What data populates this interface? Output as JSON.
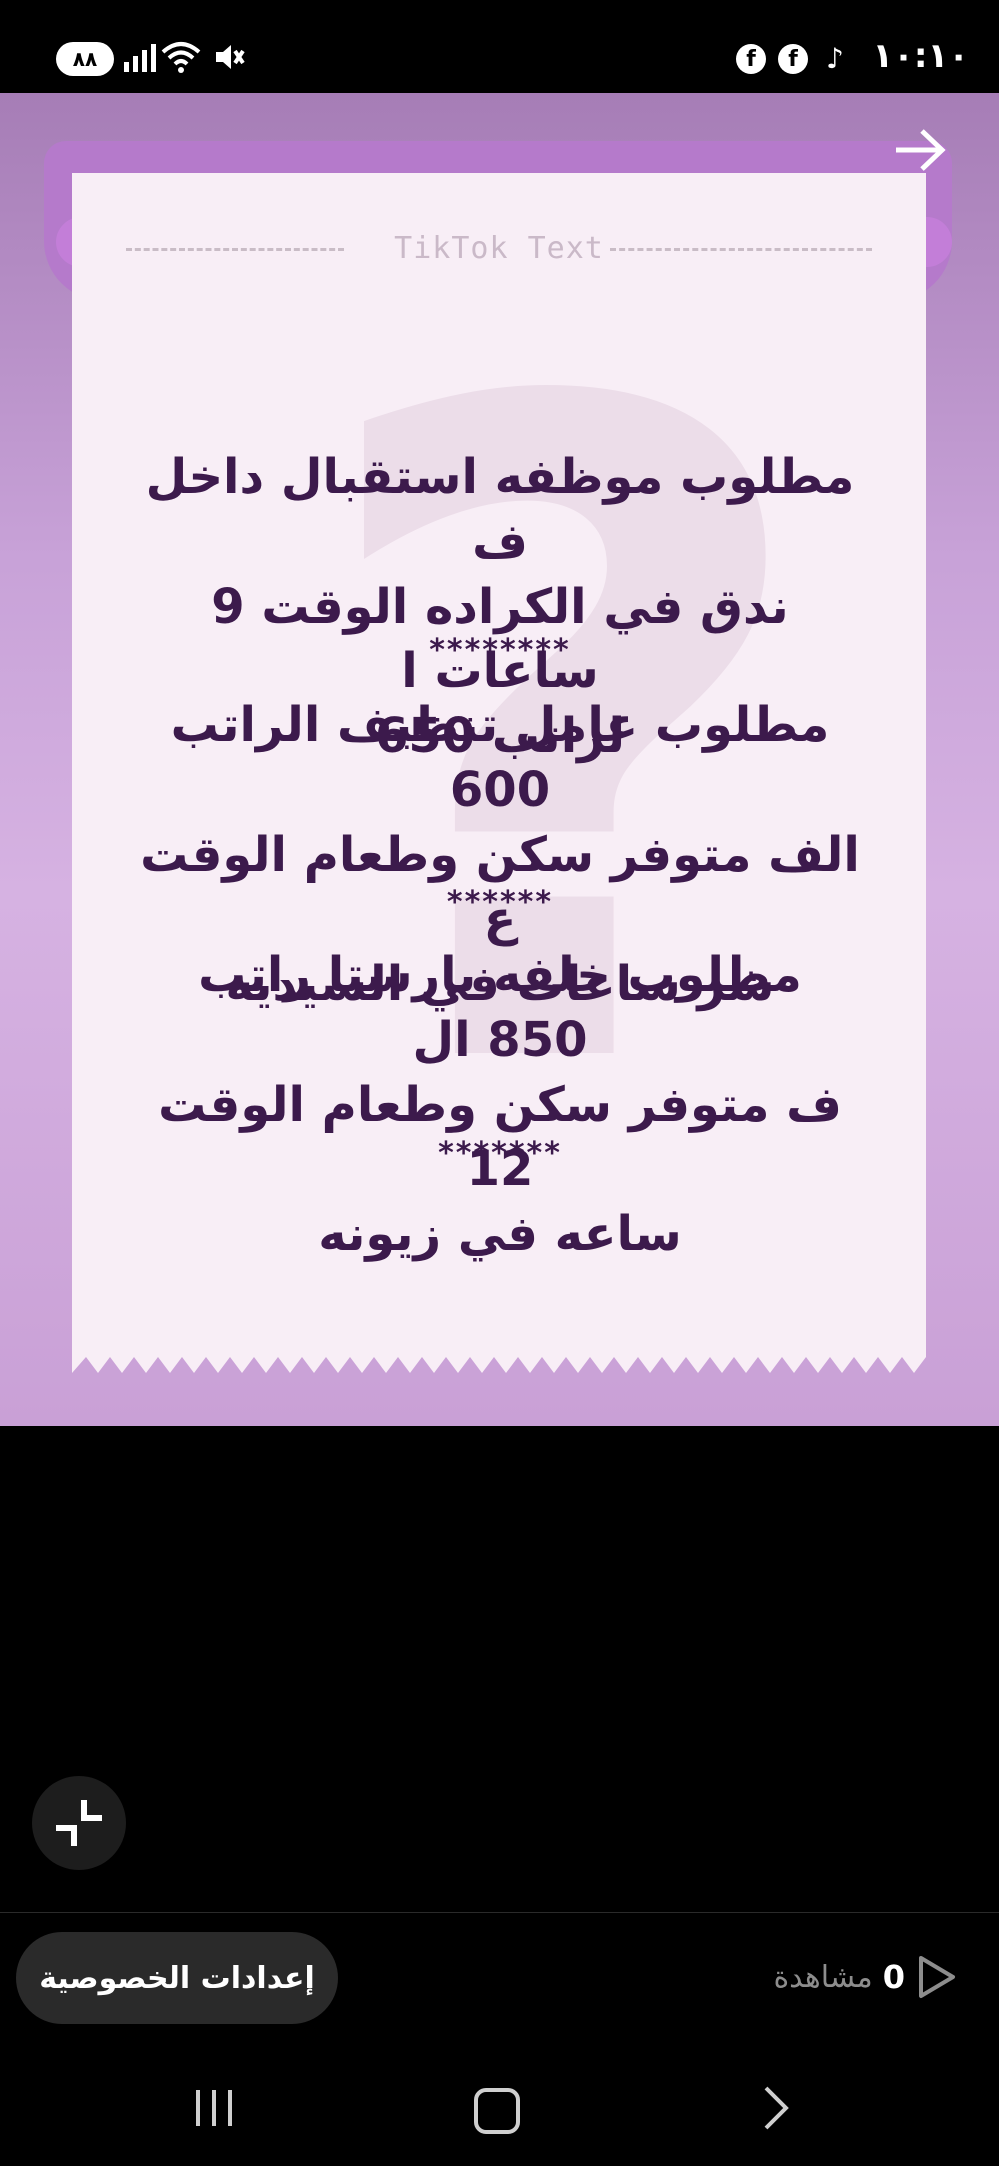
{
  "status_bar": {
    "battery": "٨٨",
    "time": "١٠:١٠",
    "icons": [
      "signal-icon",
      "wifi-icon",
      "mute-icon",
      "facebook-icon",
      "facebook-icon",
      "tiktok-icon"
    ]
  },
  "story": {
    "header_label": "TikTok Text",
    "posts": [
      {
        "lines": [
          "مطلوب موظفه استقبال داخل ف",
          "ندق في الكراده الوقت 9 ساعات ا",
          "لراتب 650"
        ],
        "separator": "********"
      },
      {
        "lines": [
          "مطلوب عامل تنظيف الراتب 600",
          "الف متوفر سكن وطعام الوقت ع",
          "شر ساعات في السيديه"
        ],
        "separator": "******"
      },
      {
        "lines": [
          "مطلوب خلفه بارستا راتب 850 ال",
          "ف متوفر سكن وطعام الوقت 12",
          "ساعه في زيونه"
        ],
        "separator": "*******"
      }
    ]
  },
  "footer": {
    "privacy_button": "إعدادات الخصوصية",
    "views_count": "0",
    "views_label": "مشاهدة"
  },
  "colors": {
    "story_bg": "#c8a2d8",
    "paper": "#f8eef6",
    "text": "#3c1a4c"
  }
}
